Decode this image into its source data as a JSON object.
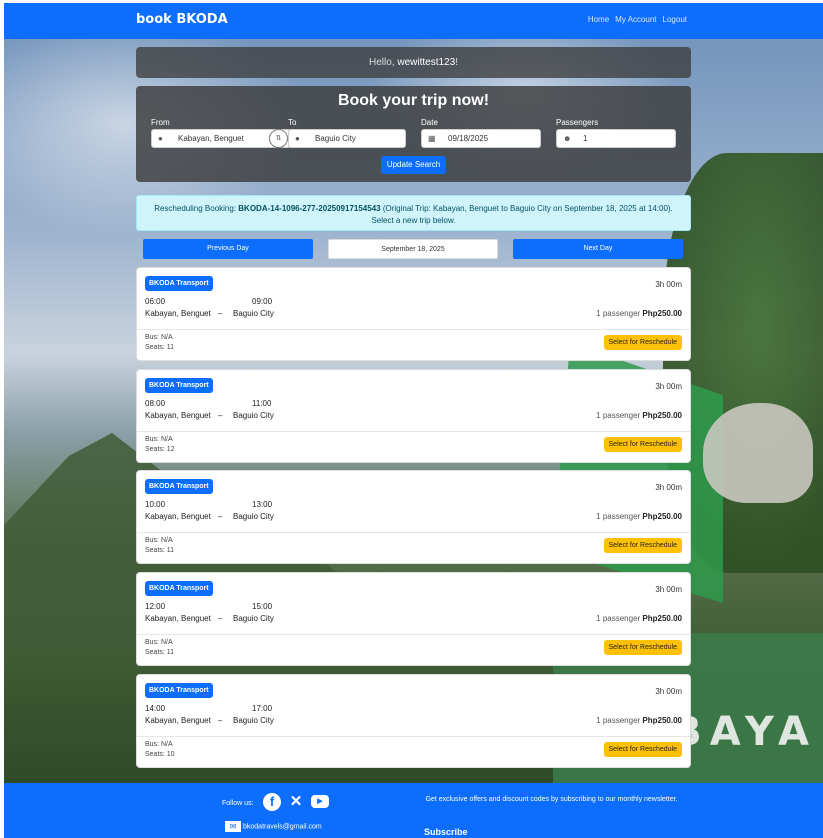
{
  "nav": {
    "brand": "book BKODA",
    "links": [
      "Home",
      "My Account",
      "Logout"
    ]
  },
  "greeting": {
    "prefix": "Hello, ",
    "username": "wewittest123",
    "suffix": "!"
  },
  "search": {
    "title": "Book your trip now!",
    "from_label": "From",
    "from_value": "Kabayan, Benguet",
    "to_label": "To",
    "to_value": "Baguio City",
    "date_label": "Date",
    "date_value": "09/18/2025",
    "passengers_label": "Passengers",
    "passengers_value": "1",
    "update_button": "Update Search"
  },
  "reschedule": {
    "prefix": "Rescheduling Booking: ",
    "booking_id": "BKODA-14-1096-277-20250917154543",
    "details": " (Original Trip: Kabayan, Benguet to Baguio City on September 18, 2025 at 14:00).",
    "instruction": "Select a new trip below."
  },
  "day_nav": {
    "previous": "Previous Day",
    "current": "September 18, 2025",
    "next": "Next Day"
  },
  "trips": [
    {
      "operator": "BKODA Transport",
      "duration": "3h 00m",
      "departure": "06:00",
      "arrival": "09:00",
      "origin": "Kabayan, Benguet",
      "destination": "Baguio City",
      "passengers": "1 passenger",
      "price": "Php250.00",
      "bus": "Bus: N/A",
      "seats": "Seats: 11",
      "action": "Select for Reschedule"
    },
    {
      "operator": "BKODA Transport",
      "duration": "3h 00m",
      "departure": "08:00",
      "arrival": "11:00",
      "origin": "Kabayan, Benguet",
      "destination": "Baguio City",
      "passengers": "1 passenger",
      "price": "Php250.00",
      "bus": "Bus: N/A",
      "seats": "Seats: 12",
      "action": "Select for Reschedule"
    },
    {
      "operator": "BKODA Transport",
      "duration": "3h 00m",
      "departure": "10:00",
      "arrival": "13:00",
      "origin": "Kabayan, Benguet",
      "destination": "Baguio City",
      "passengers": "1 passenger",
      "price": "Php250.00",
      "bus": "Bus: N/A",
      "seats": "Seats: 11",
      "action": "Select for Reschedule"
    },
    {
      "operator": "BKODA Transport",
      "duration": "3h 00m",
      "departure": "12:00",
      "arrival": "15:00",
      "origin": "Kabayan, Benguet",
      "destination": "Baguio City",
      "passengers": "1 passenger",
      "price": "Php250.00",
      "bus": "Bus: N/A",
      "seats": "Seats: 11",
      "action": "Select for Reschedule"
    },
    {
      "operator": "BKODA Transport",
      "duration": "3h 00m",
      "departure": "14:00",
      "arrival": "17:00",
      "origin": "Kabayan, Benguet",
      "destination": "Baguio City",
      "passengers": "1 passenger",
      "price": "Php250.00",
      "bus": "Bus: N/A",
      "seats": "Seats: 10",
      "action": "Select for Reschedule"
    }
  ],
  "trip_separator": "–",
  "footer": {
    "follow_label": "Follow us:",
    "social_icons": [
      "facebook-icon",
      "x-icon",
      "youtube-icon"
    ],
    "email": "bkodatravels@gmail.com",
    "promo": "Get exclusive offers and discount codes by subscribing to our monthly newsletter.",
    "subscribe": "Subscribe"
  },
  "background_text": "E TO BAYA",
  "colors": {
    "primary": "#0d6efd",
    "warning": "#ffc107",
    "info_bg": "#cff4fc",
    "info_text": "#055160"
  }
}
